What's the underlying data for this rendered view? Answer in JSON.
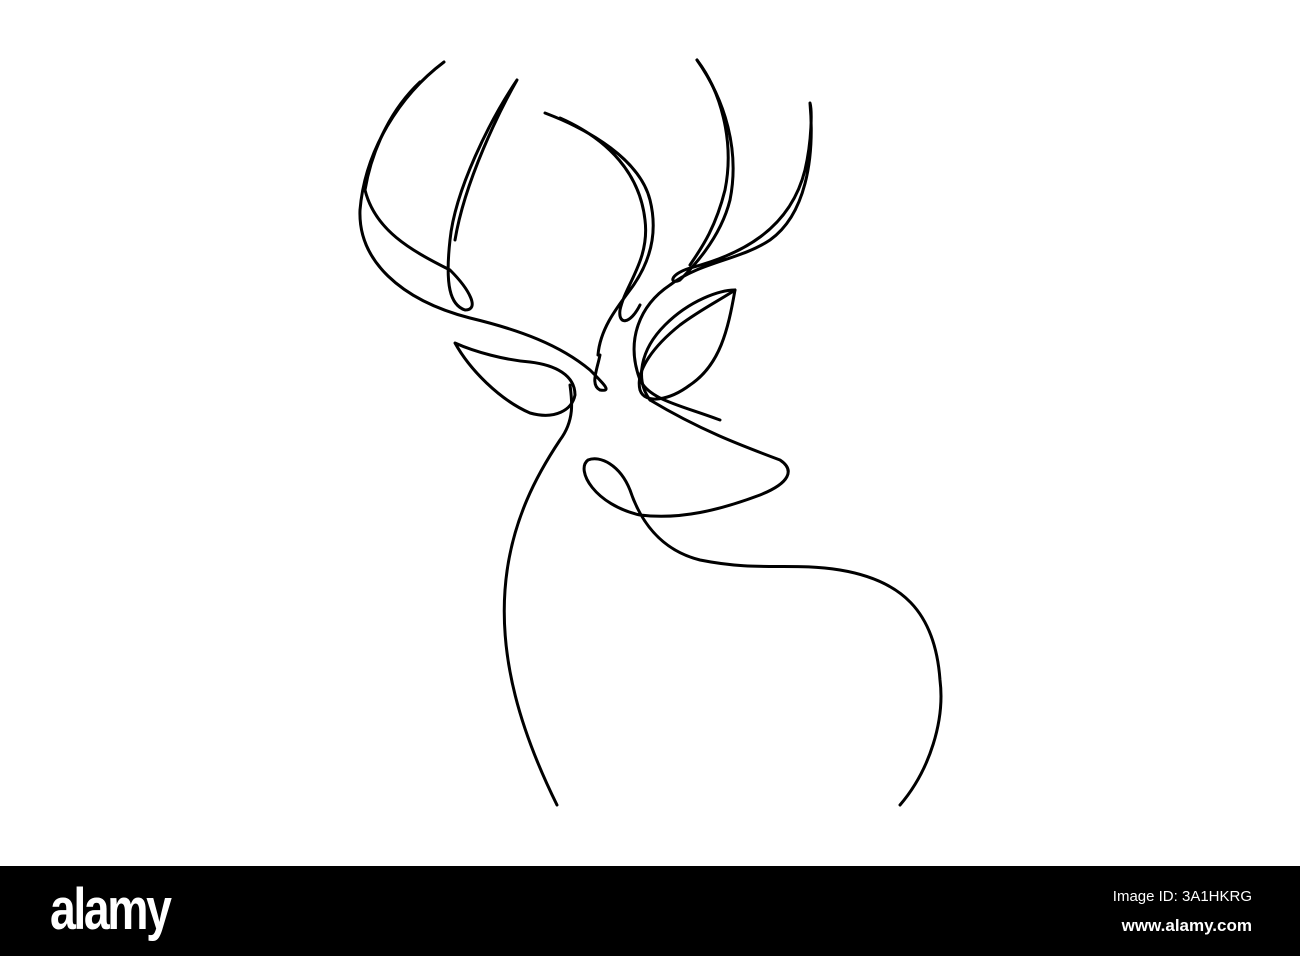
{
  "watermark": {
    "logo": "alamy",
    "image_id": "Image ID: 3A1HKRG",
    "website": "www.alamy.com"
  },
  "colors": {
    "line": "#000000",
    "background": "#ffffff",
    "bar": "#000000"
  }
}
